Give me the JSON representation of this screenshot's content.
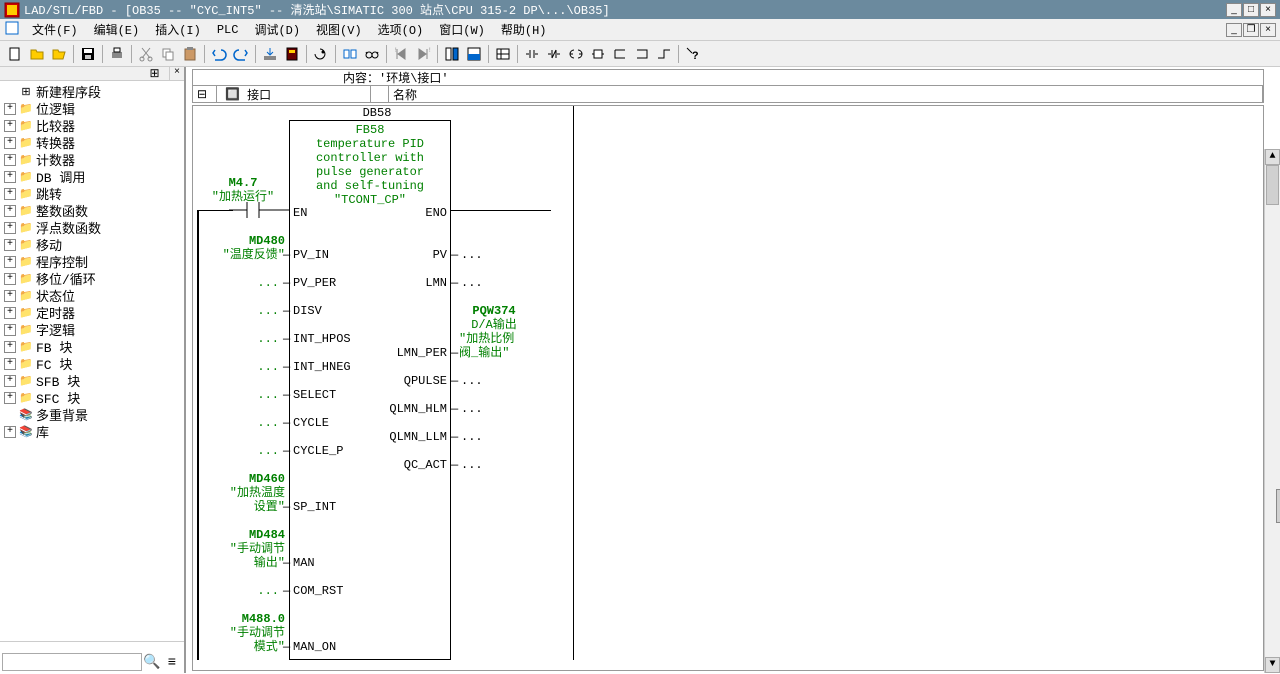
{
  "title": "LAD/STL/FBD  - [OB35 -- \"CYC_INT5\" -- 清洗站\\SIMATIC 300 站点\\CPU 315-2 DP\\...\\OB35]",
  "menu": {
    "file": "文件(F)",
    "edit": "编辑(E)",
    "insert": "插入(I)",
    "plc": "PLC",
    "debug": "调试(D)",
    "view": "视图(V)",
    "options": "选项(O)",
    "window": "窗口(W)",
    "help": "帮助(H)"
  },
  "tree": {
    "new_segment": "新建程序段",
    "bit_logic": "位逻辑",
    "comparator": "比较器",
    "converter": "转换器",
    "counter": "计数器",
    "db_call": "DB 调用",
    "jump": "跳转",
    "int_func": "整数函数",
    "float_func": "浮点数函数",
    "move": "移动",
    "prog_ctrl": "程序控制",
    "shift_rot": "移位/循环",
    "status_bit": "状态位",
    "timer": "定时器",
    "word_logic": "字逻辑",
    "fb": "FB 块",
    "fc": "FC 块",
    "sfb": "SFB 块",
    "sfc": "SFC 块",
    "multi": "多重背景",
    "lib": "库"
  },
  "content": {
    "header": "内容：'环境\\接口'",
    "interface": "接口",
    "name": "名称"
  },
  "block": {
    "db": "DB58",
    "fb": "FB58",
    "desc1": "temperature PID",
    "desc2": "controller with",
    "desc3": "pulse generator",
    "desc4": "and self-tuning",
    "name": "\"TCONT_CP\"",
    "en": "EN",
    "eno": "ENO",
    "pins_left": [
      {
        "addr": "M4.7",
        "sym": "\"加热运行\"",
        "pin": ""
      },
      {
        "addr": "MD480",
        "sym": "\"温度反馈\"",
        "pin": "PV_IN"
      },
      {
        "addr": "",
        "sym": "...",
        "pin": "PV_PER"
      },
      {
        "addr": "",
        "sym": "...",
        "pin": "DISV"
      },
      {
        "addr": "",
        "sym": "...",
        "pin": "INT_HPOS"
      },
      {
        "addr": "",
        "sym": "...",
        "pin": "INT_HNEG"
      },
      {
        "addr": "",
        "sym": "...",
        "pin": "SELECT"
      },
      {
        "addr": "",
        "sym": "...",
        "pin": "CYCLE"
      },
      {
        "addr": "",
        "sym": "...",
        "pin": "CYCLE_P"
      },
      {
        "addr": "MD460",
        "sym": "\"加热温度",
        "sym2": "设置\"",
        "pin": "SP_INT"
      },
      {
        "addr": "MD484",
        "sym": "\"手动调节",
        "sym2": "输出\"",
        "pin": "MAN"
      },
      {
        "addr": "",
        "sym": "...",
        "pin": "COM_RST"
      },
      {
        "addr": "M488.0",
        "sym": "\"手动调节",
        "sym2": "模式\"",
        "pin": "MAN_ON"
      }
    ],
    "pins_right": [
      {
        "pin": "PV",
        "val": "..."
      },
      {
        "pin": "LMN",
        "val": "..."
      },
      {
        "pin": "LMN_PER",
        "val": "",
        "addr": "PQW374",
        "sym1": "D/A输出",
        "sym2": "\"加热比例",
        "sym3": "阀_输出\""
      },
      {
        "pin": "QPULSE",
        "val": "..."
      },
      {
        "pin": "QLMN_HLM",
        "val": "..."
      },
      {
        "pin": "QLMN_LLM",
        "val": "..."
      },
      {
        "pin": "QC_ACT",
        "val": "..."
      }
    ]
  }
}
